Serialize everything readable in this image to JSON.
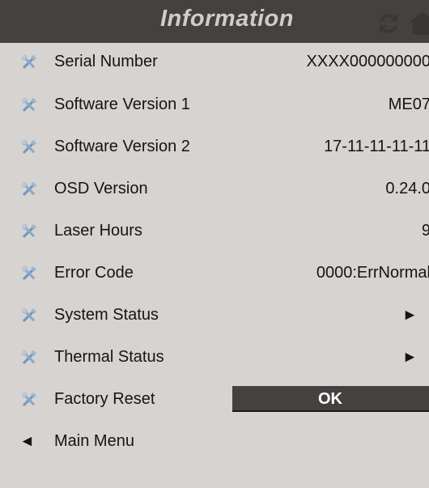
{
  "header": {
    "title": "Information",
    "refresh_icon": "refresh-icon",
    "home_icon": "home-icon"
  },
  "items": [
    {
      "label": "Serial Number",
      "value": "XXXX000000000",
      "icon": "wrench-screwdriver-icon"
    },
    {
      "label": "Software Version 1",
      "value": "ME07",
      "icon": "wrench-screwdriver-icon"
    },
    {
      "label": "Software Version 2",
      "value": "17-11-11-11-11",
      "icon": "wrench-screwdriver-icon"
    },
    {
      "label": "OSD Version",
      "value": "0.24.0",
      "icon": "wrench-screwdriver-icon"
    },
    {
      "label": "Laser Hours",
      "value": "9",
      "icon": "wrench-screwdriver-icon"
    },
    {
      "label": "Error Code",
      "value": "0000:ErrNormal",
      "icon": "wrench-screwdriver-icon"
    },
    {
      "label": "System Status",
      "value": "►",
      "icon": "wrench-screwdriver-icon"
    },
    {
      "label": "Thermal Status",
      "value": "►",
      "icon": "wrench-screwdriver-icon"
    },
    {
      "label": "Factory Reset",
      "value": "OK",
      "icon": "wrench-screwdriver-icon"
    }
  ],
  "back": {
    "arrow": "◄",
    "label": "Main Menu"
  },
  "colors": {
    "background": "#d6d3d1",
    "header": "#454141",
    "title_text": "#cfcccb",
    "ok_text": "#ffffff"
  }
}
